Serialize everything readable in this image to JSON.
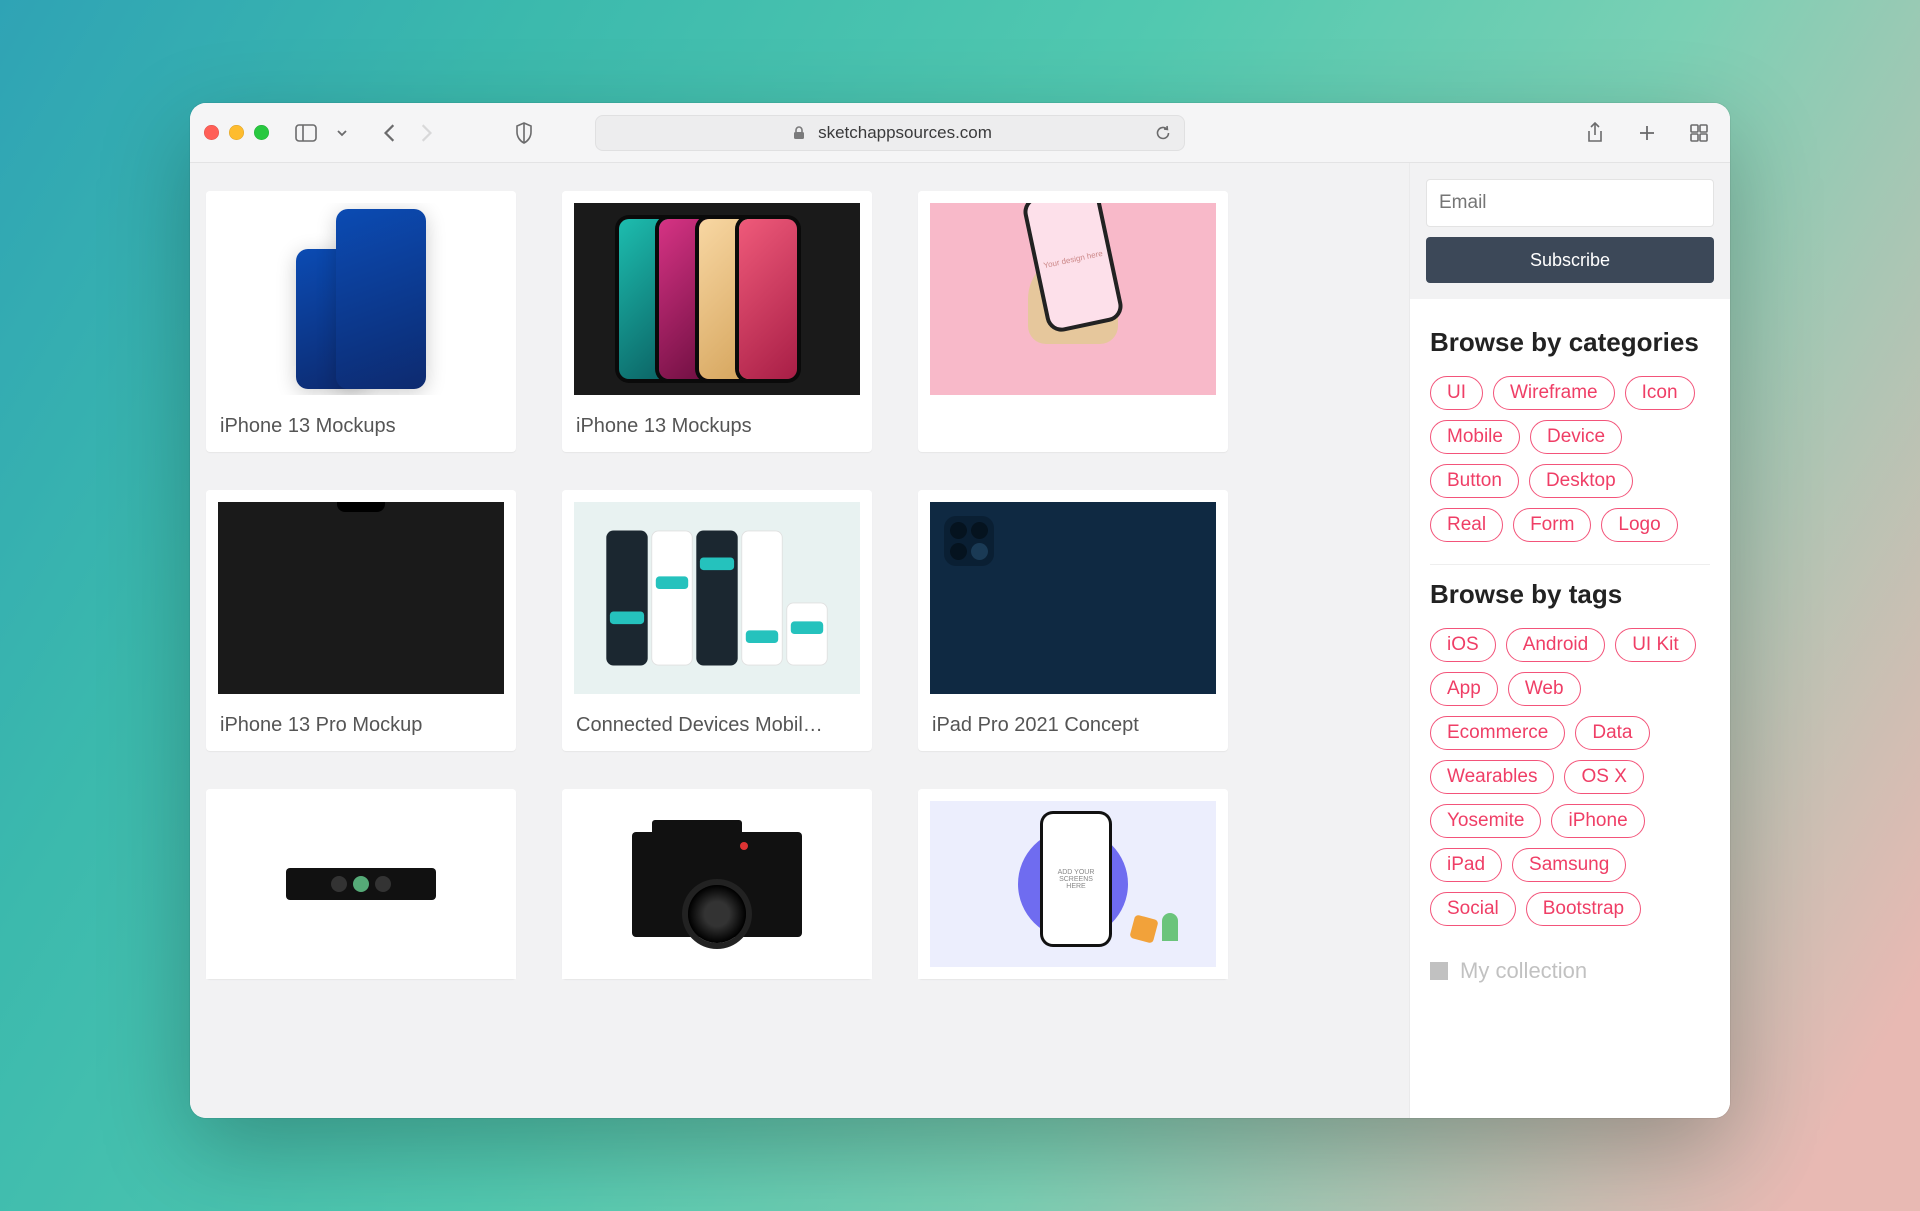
{
  "browser": {
    "url_display": "sketchappsources.com"
  },
  "email": {
    "placeholder": "Email"
  },
  "subscribe_label": "Subscribe",
  "categories": {
    "title": "Browse by categories",
    "items": [
      "UI",
      "Wireframe",
      "Icon",
      "Mobile",
      "Device",
      "Button",
      "Desktop",
      "Real",
      "Form",
      "Logo"
    ]
  },
  "tags": {
    "title": "Browse by tags",
    "items": [
      "iOS",
      "Android",
      "UI Kit",
      "App",
      "Web",
      "Ecommerce",
      "Data",
      "Wearables",
      "OS X",
      "Yosemite",
      "iPhone",
      "iPad",
      "Samsung",
      "Social",
      "Bootstrap"
    ]
  },
  "my_collection_label": "My collection",
  "cards": [
    {
      "title": "iPhone 13 Mockups"
    },
    {
      "title": "iPhone 13 Mockups"
    },
    {
      "title": ""
    },
    {
      "title": "iPhone 13 Pro Mockup"
    },
    {
      "title": "Connected Devices Mobil…"
    },
    {
      "title": "iPad Pro 2021 Concept"
    },
    {
      "title": ""
    },
    {
      "title": ""
    },
    {
      "title": ""
    }
  ],
  "phone_placeholder_text": "Your design here",
  "screens_text": "ADD YOUR SCREENS HERE"
}
